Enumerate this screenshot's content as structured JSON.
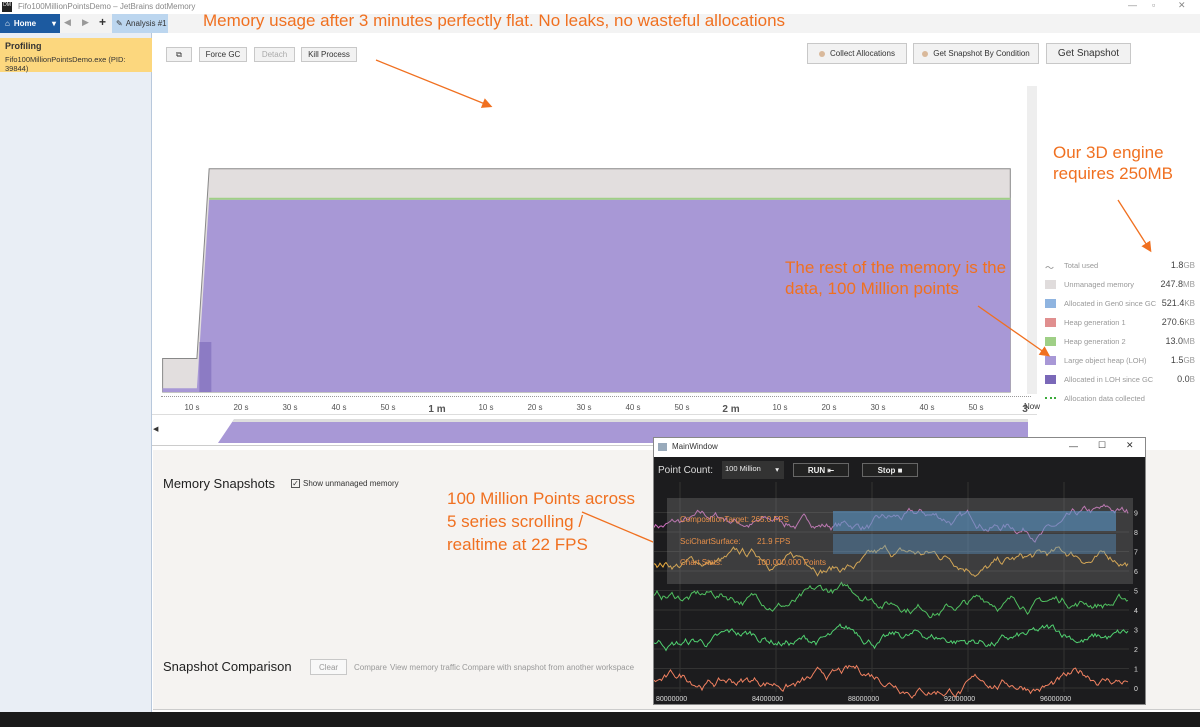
{
  "window": {
    "title": "Fifo100MillionPointsDemo – JetBrains dotMemory",
    "app_icon": "DM"
  },
  "toolbar": {
    "home": "Home",
    "tab": "Analysis #1"
  },
  "sidebar": {
    "profiling_title": "Profiling",
    "process": "Fifo100MillionPointsDemo.exe (PID: 39844)"
  },
  "actions": {
    "force_gc": "Force GC",
    "detach": "Detach",
    "kill": "Kill Process",
    "collect": "Collect Allocations",
    "snapshot_condition": "Get Snapshot By Condition",
    "get_snapshot": "Get Snapshot"
  },
  "legend": [
    {
      "label": "Total used",
      "num": "1.8",
      "unit": "GB",
      "color": "#888888"
    },
    {
      "label": "Unmanaged memory",
      "num": "247.8",
      "unit": "MB",
      "color": "#e0dcdc"
    },
    {
      "label": "Allocated in Gen0 since GC",
      "num": "521.4",
      "unit": "KB",
      "color": "#8fb4e0"
    },
    {
      "label": "Heap generation 1",
      "num": "270.6",
      "unit": "KB",
      "color": "#e08f8f"
    },
    {
      "label": "Heap generation 2",
      "num": "13.0",
      "unit": "MB",
      "color": "#9fcf86"
    },
    {
      "label": "Large object heap (LOH)",
      "num": "1.5",
      "unit": "GB",
      "color": "#a898d6"
    },
    {
      "label": "Allocated in LOH since GC",
      "num": "0.0",
      "unit": "B",
      "color": "#7a68b8"
    },
    {
      "label": "Allocation data collected",
      "num": "",
      "unit": "",
      "color": "#3aaa3a"
    }
  ],
  "chart_data": [
    {
      "type": "area",
      "title": "",
      "x_unit": "s",
      "x": [
        4,
        11,
        13.5,
        177
      ],
      "series": [
        {
          "name": "Total used",
          "values": [
            0.27,
            0.27,
            1.8,
            1.8
          ]
        },
        {
          "name": "Large object heap (LOH)",
          "values": [
            0.03,
            0.03,
            1.55,
            1.55
          ]
        }
      ],
      "y_unit": "GB",
      "x_ticks": [
        "10 s",
        "20 s",
        "30 s",
        "40 s",
        "50 s",
        "1 m",
        "10 s",
        "20 s",
        "30 s",
        "40 s",
        "50 s",
        "2 m",
        "10 s",
        "20 s",
        "30 s",
        "40 s",
        "50 s",
        "3"
      ],
      "now_label": "Now"
    },
    {
      "type": "line",
      "title": "",
      "y_ticks": [
        "0",
        "1",
        "2",
        "3",
        "4",
        "5",
        "6",
        "7",
        "8",
        "9"
      ],
      "x_ticks": [
        "80000000",
        "84000000",
        "88000000",
        "92000000",
        "96000000"
      ],
      "series_levels": [
        8.4,
        6.5,
        4.6,
        2.4,
        0.4
      ],
      "series_colors": [
        "#d070c0",
        "#f0b040",
        "#50c060",
        "#50d070",
        "#f08060"
      ]
    }
  ],
  "snapshots": {
    "title": "Memory Snapshots",
    "show_unmanaged": "Show unmanaged memory"
  },
  "comparison": {
    "title": "Snapshot Comparison",
    "clear": "Clear",
    "compare": "Compare",
    "traffic": "View memory traffic",
    "other": "Compare with snapshot from another workspace"
  },
  "annotations": {
    "top": "Memory usage after 3 minutes perfectly flat. No leaks, no wasteful allocations",
    "engine": "Our 3D engine requires 250MB",
    "rest": "The rest of the memory is the data, 100 Million points",
    "points": "100 Million Points across 5 series scrolling / realtime at 22 FPS"
  },
  "main_window": {
    "title": "MainWindow",
    "point_count_label": "Point Count:",
    "point_count": "100 Million",
    "run": "RUN ⇤",
    "stop": "Stop ■",
    "stats": {
      "composition": "CompositionTarget: 265.0 FPS",
      "surface_label": "SciChartSurface:",
      "surface_fps": "21.9 FPS",
      "stats_label": "Chart Stats:",
      "stats_value": "100,000,000 Points"
    }
  }
}
